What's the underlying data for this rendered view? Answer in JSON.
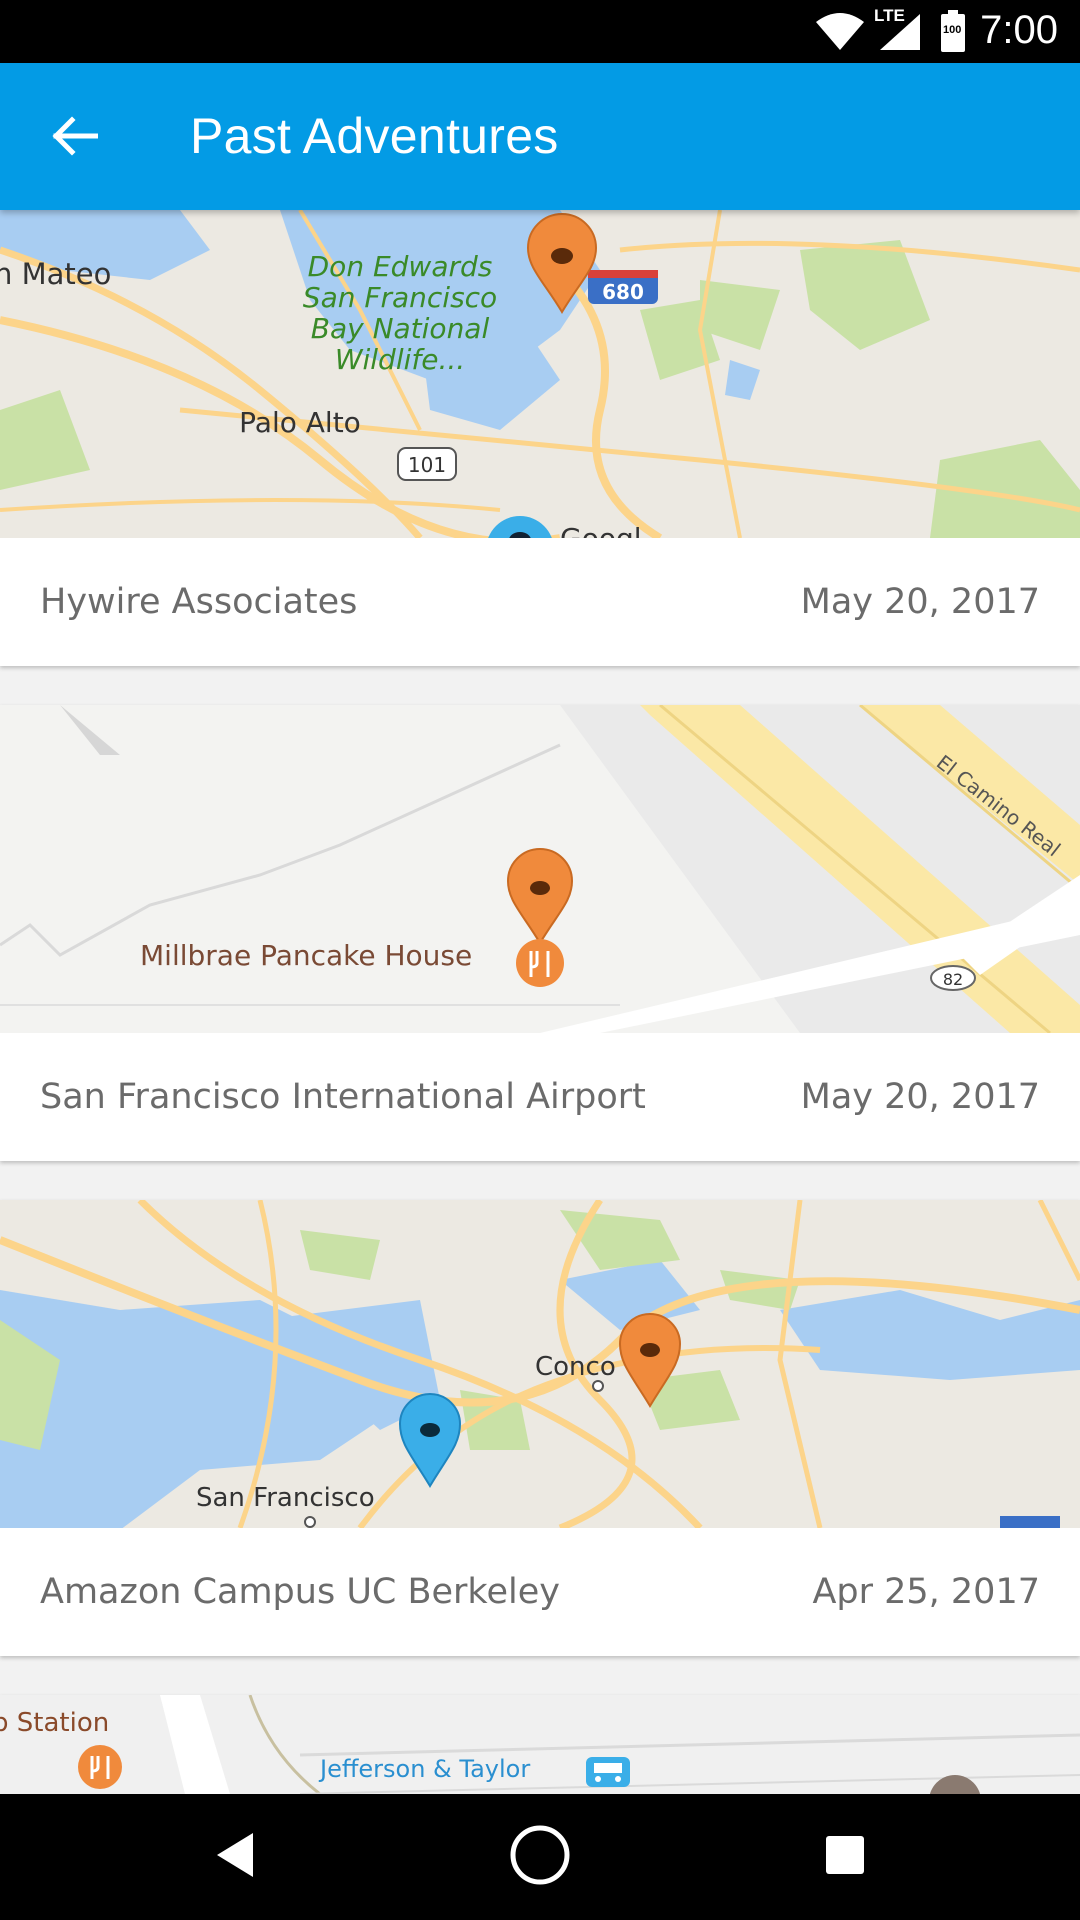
{
  "status_bar": {
    "time": "7:00",
    "network": "LTE",
    "battery": "100"
  },
  "app_bar": {
    "title": "Past Adventures",
    "back_icon": "arrow-left-icon"
  },
  "adventures": [
    {
      "name": "Hywire Associates",
      "date": "May 20, 2017",
      "map_labels": {
        "place1": "n Mateo",
        "park_line1": "Don Edwards",
        "park_line2": "San Francisco",
        "park_line3": "Bay National",
        "park_line4": "Wildlife...",
        "city": "Palo Alto",
        "hwy1": "101",
        "hwy2": "680"
      }
    },
    {
      "name": "San Francisco International Airport",
      "date": "May 20, 2017",
      "map_labels": {
        "poi": "Millbrae Pancake House",
        "road": "El Camino Real",
        "hwy": "82"
      }
    },
    {
      "name": "Amazon Campus UC Berkeley",
      "date": "Apr 25, 2017",
      "map_labels": {
        "city1": "Conco",
        "city2": "San Francisco"
      }
    },
    {
      "map_labels": {
        "station": "b Station",
        "stop": "Jefferson & Taylor"
      }
    }
  ],
  "colors": {
    "app_bar": "#039be5",
    "pin_orange": "#f08a3c",
    "pin_blue": "#3aaee8",
    "water": "#a8cdf2",
    "park": "#c9e1a6",
    "road": "#fcd48a"
  }
}
